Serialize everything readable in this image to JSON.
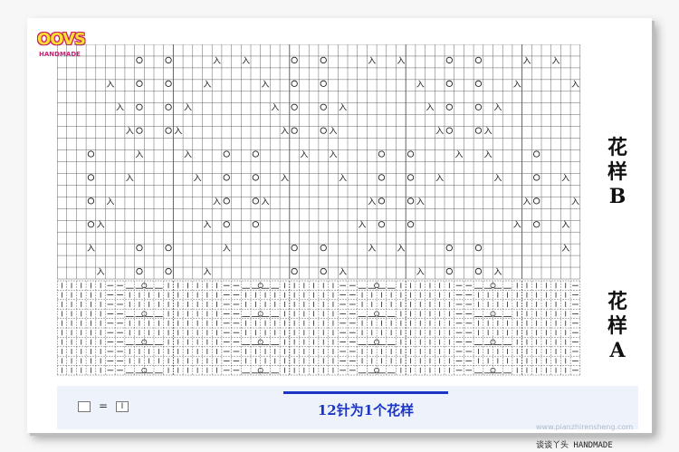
{
  "logo": {
    "text": "OOVS",
    "subtitle": "HANDMADE"
  },
  "labels": {
    "pattern_b": [
      "花",
      "样",
      "B"
    ],
    "pattern_a": [
      "花",
      "样",
      "A"
    ]
  },
  "footer": {
    "note": "12针为1个花样",
    "legend_equals": "=",
    "legend_symbol": "I"
  },
  "watermark": {
    "text": "",
    "url": "www.pianzhirensheng.com"
  },
  "credit": "谈谈丫头 HANDMADE",
  "chart": {
    "cols": 54,
    "rows_b": 20,
    "rows_a": 10,
    "stitches_per_repeat": 12,
    "yarnover_symbol": "O",
    "decrease_symbol": "入",
    "knit_symbol": "I",
    "purl_symbol": "—",
    "line_color": "#555555",
    "chart_b_symbols": [
      [
        [
          8,
          "O"
        ],
        [
          11,
          "O"
        ],
        [
          16,
          "入"
        ],
        [
          19,
          "入"
        ],
        [
          24,
          "O"
        ],
        [
          27,
          "O"
        ],
        [
          32,
          "入"
        ],
        [
          35,
          "入"
        ],
        [
          40,
          "O"
        ],
        [
          43,
          "O"
        ],
        [
          48,
          "入"
        ],
        [
          51,
          "入"
        ]
      ],
      [
        [
          5,
          "入"
        ],
        [
          8,
          "O"
        ],
        [
          11,
          "O"
        ],
        [
          15,
          "入"
        ],
        [
          21,
          "入"
        ],
        [
          24,
          "O"
        ],
        [
          27,
          "O"
        ],
        [
          37,
          "入"
        ],
        [
          40,
          "O"
        ],
        [
          43,
          "O"
        ],
        [
          47,
          "入"
        ],
        [
          53,
          "入"
        ]
      ],
      [
        [
          6,
          "入"
        ],
        [
          8,
          "O"
        ],
        [
          11,
          "O"
        ],
        [
          13,
          "入"
        ],
        [
          22,
          "入"
        ],
        [
          24,
          "O"
        ],
        [
          27,
          "O"
        ],
        [
          29,
          "入"
        ],
        [
          38,
          "入"
        ],
        [
          40,
          "O"
        ],
        [
          43,
          "O"
        ],
        [
          45,
          "入"
        ]
      ],
      [
        [
          7,
          "入"
        ],
        [
          8,
          "O"
        ],
        [
          11,
          "O"
        ],
        [
          12,
          "入"
        ],
        [
          23,
          "入"
        ],
        [
          24,
          "O"
        ],
        [
          27,
          "O"
        ],
        [
          28,
          "入"
        ],
        [
          39,
          "入"
        ],
        [
          40,
          "O"
        ],
        [
          43,
          "O"
        ],
        [
          44,
          "入"
        ]
      ],
      [
        [
          3,
          "O"
        ],
        [
          8,
          "入"
        ],
        [
          13,
          "入"
        ],
        [
          17,
          "O"
        ],
        [
          20,
          "O"
        ],
        [
          25,
          "入"
        ],
        [
          28,
          "入"
        ],
        [
          33,
          "O"
        ],
        [
          36,
          "O"
        ],
        [
          41,
          "入"
        ],
        [
          44,
          "入"
        ],
        [
          49,
          "O"
        ]
      ],
      [
        [
          3,
          "O"
        ],
        [
          7,
          "入"
        ],
        [
          14,
          "入"
        ],
        [
          17,
          "O"
        ],
        [
          20,
          "O"
        ],
        [
          23,
          "入"
        ],
        [
          29,
          "入"
        ],
        [
          33,
          "O"
        ],
        [
          36,
          "O"
        ],
        [
          39,
          "入"
        ],
        [
          45,
          "入"
        ],
        [
          49,
          "O"
        ],
        [
          52,
          "入"
        ]
      ],
      [
        [
          3,
          "O"
        ],
        [
          5,
          "入"
        ],
        [
          16,
          "入"
        ],
        [
          17,
          "O"
        ],
        [
          20,
          "O"
        ],
        [
          21,
          "入"
        ],
        [
          32,
          "入"
        ],
        [
          33,
          "O"
        ],
        [
          36,
          "O"
        ],
        [
          37,
          "入"
        ],
        [
          48,
          "入"
        ],
        [
          49,
          "O"
        ],
        [
          53,
          "入"
        ]
      ],
      [
        [
          3,
          "O"
        ],
        [
          4,
          "入"
        ],
        [
          15,
          "入"
        ],
        [
          17,
          "O"
        ],
        [
          20,
          "O"
        ],
        [
          31,
          "入"
        ],
        [
          33,
          "O"
        ],
        [
          36,
          "O"
        ],
        [
          47,
          "入"
        ],
        [
          49,
          "O"
        ],
        [
          52,
          "入"
        ]
      ],
      [
        [
          3,
          "入"
        ],
        [
          8,
          "O"
        ],
        [
          11,
          "O"
        ],
        [
          17,
          "入"
        ],
        [
          24,
          "O"
        ],
        [
          27,
          "O"
        ],
        [
          32,
          "入"
        ],
        [
          35,
          "入"
        ],
        [
          40,
          "O"
        ],
        [
          43,
          "O"
        ],
        [
          52,
          "入"
        ]
      ],
      [
        [
          4,
          "入"
        ],
        [
          8,
          "O"
        ],
        [
          11,
          "O"
        ],
        [
          15,
          "入"
        ],
        [
          24,
          "O"
        ],
        [
          27,
          "O"
        ],
        [
          29,
          "入"
        ],
        [
          37,
          "入"
        ],
        [
          40,
          "O"
        ],
        [
          43,
          "O"
        ],
        [
          45,
          "入"
        ]
      ],
      [
        [
          7,
          "入"
        ],
        [
          8,
          "O"
        ],
        [
          11,
          "O"
        ],
        [
          12,
          "入"
        ],
        [
          23,
          "入"
        ],
        [
          24,
          "O"
        ],
        [
          27,
          "O"
        ],
        [
          28,
          "入"
        ],
        [
          39,
          "入"
        ],
        [
          40,
          "O"
        ],
        [
          43,
          "O"
        ],
        [
          44,
          "入"
        ]
      ],
      [
        [
          7,
          "入"
        ],
        [
          8,
          "O"
        ],
        [
          11,
          "O"
        ],
        [
          12,
          "入"
        ],
        [
          23,
          "入"
        ],
        [
          24,
          "O"
        ],
        [
          27,
          "O"
        ],
        [
          28,
          "入"
        ],
        [
          39,
          "入"
        ],
        [
          40,
          "O"
        ],
        [
          43,
          "O"
        ],
        [
          44,
          "入"
        ]
      ]
    ]
  }
}
